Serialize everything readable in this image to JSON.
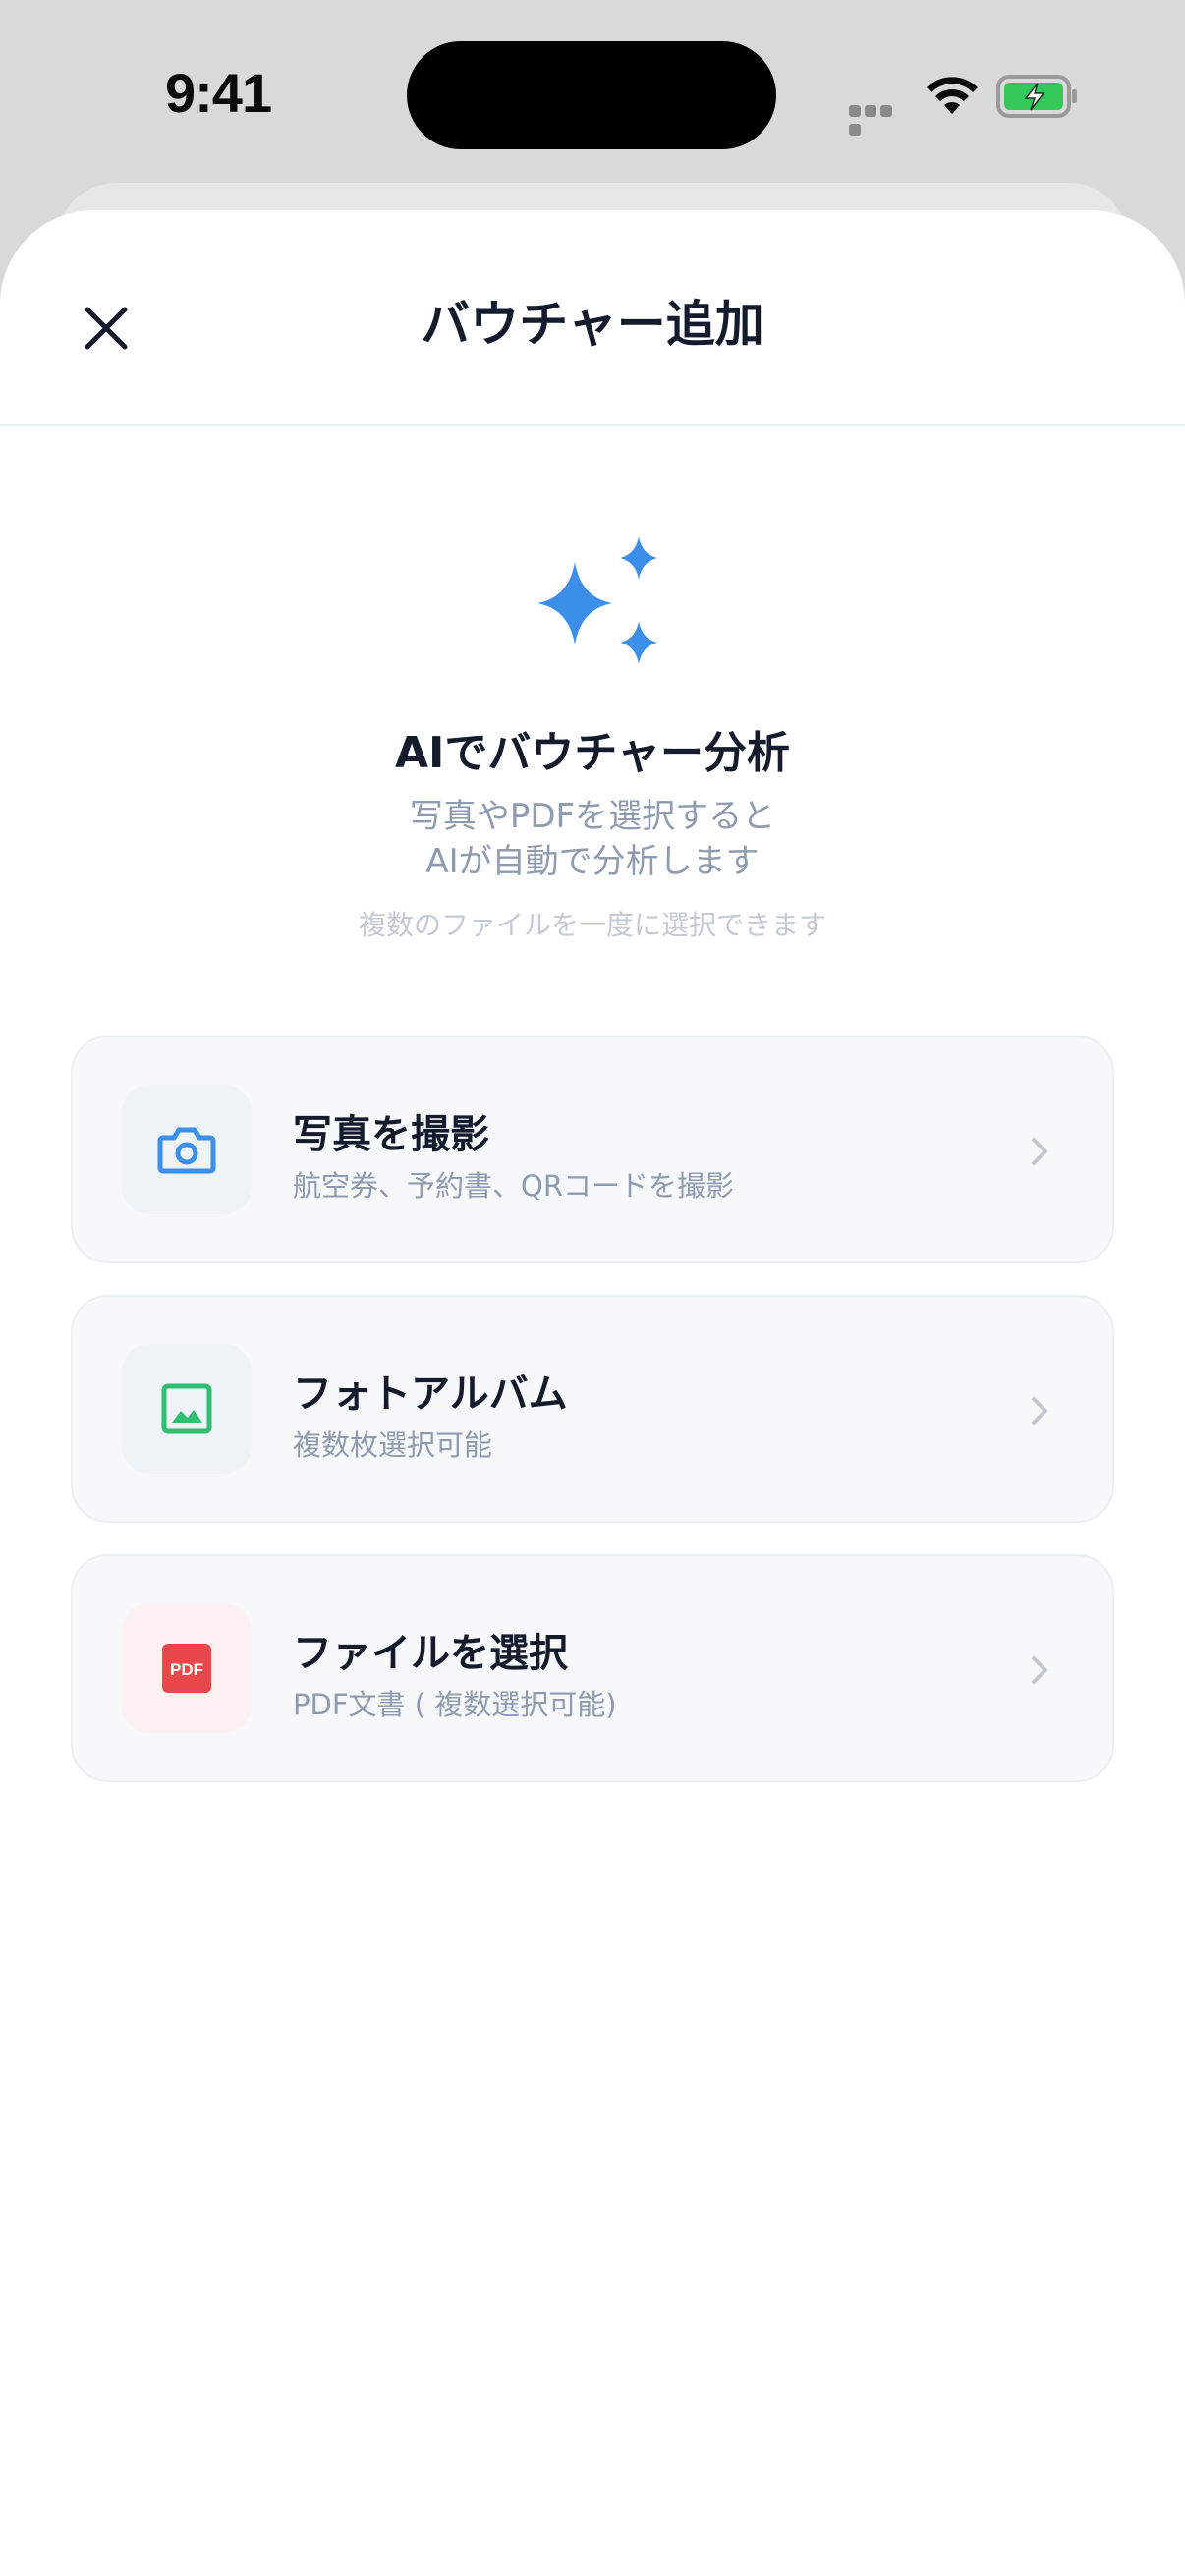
{
  "status_bar": {
    "time": "9:41",
    "battery_color": "#34c759"
  },
  "header": {
    "title": "バウチャー追加",
    "close_icon": "close-icon"
  },
  "hero": {
    "icon": "sparkle-icon",
    "title": "AIでバウチャー分析",
    "description_line1": "写真やPDFを選択すると",
    "description_line2": "AIが自動で分析します",
    "note": "複数のファイルを一度に選択できます",
    "accent_color": "#3b8fe8"
  },
  "options": [
    {
      "title": "写真を撮影",
      "subtitle": "航空券、予約書、QRコードを撮影",
      "icon": "camera-icon",
      "icon_color": "#3b8fe8",
      "icon_bg": "#eef3f7"
    },
    {
      "title": "フォトアルバム",
      "subtitle": "複数枚選択可能",
      "icon": "image-icon",
      "icon_color": "#2fbf71",
      "icon_bg": "#eef3f7"
    },
    {
      "title": "ファイルを選択",
      "subtitle": "PDF文書 ( 複数選択可能)",
      "icon": "pdf-icon",
      "icon_label": "PDF",
      "icon_color": "#e8484a",
      "icon_bg": "#fdf0f0"
    }
  ]
}
